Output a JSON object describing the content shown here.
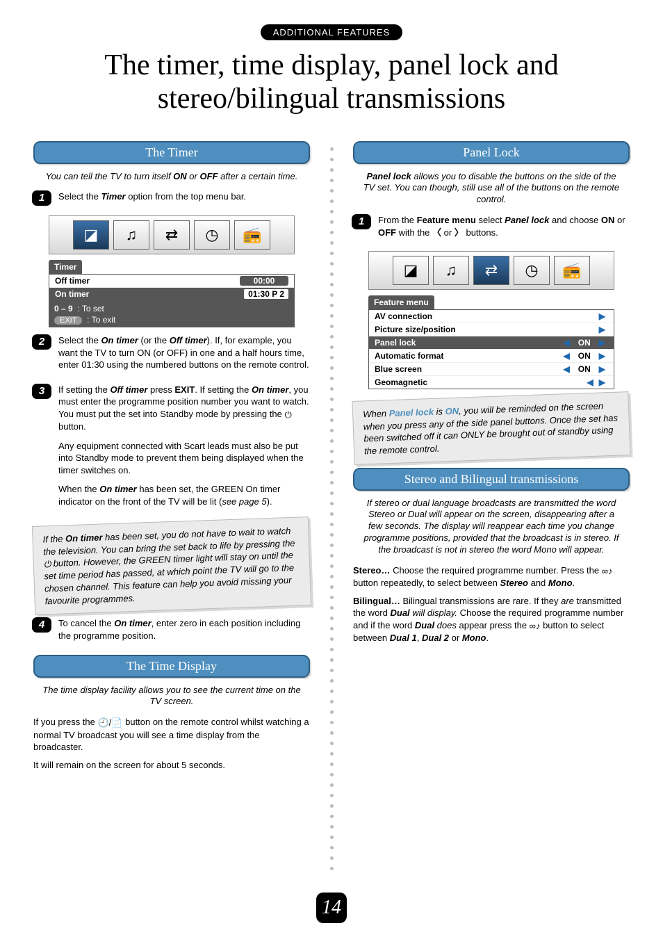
{
  "header": {
    "pill": "ADDITIONAL FEATURES",
    "title": "The timer, time display, panel lock and stereo/bilingual transmissions"
  },
  "page_number": "14",
  "left": {
    "timer": {
      "heading": "The Timer",
      "intro_a": "You can tell the TV to turn itself ",
      "intro_on": "ON",
      "intro_b": " or ",
      "intro_off": "OFF",
      "intro_c": " after a certain time.",
      "step1_a": "Select the ",
      "step1_timer": "Timer",
      "step1_b": " option from the top menu bar.",
      "menu_title": "Timer",
      "row_off_label": "Off timer",
      "row_off_val": "00:00",
      "row_on_label": "On timer",
      "row_on_val": "01:30  P 2",
      "footer_keys": "0 – 9",
      "footer_keys_label": ": To set",
      "footer_exit": "EXIT",
      "footer_exit_label": ": To exit",
      "step2_a": "Select the ",
      "step2_on": "On timer",
      "step2_b": " (or the ",
      "step2_off": "Off timer",
      "step2_c": "). If, for example, you want the TV to turn ON (or OFF) in one and a half hours time, enter 01:30 using the numbered buttons on the remote control.",
      "step3_a": "If setting the ",
      "step3_off": "Off timer",
      "step3_b": " press ",
      "step3_exit": "EXIT",
      "step3_c": ". If setting the ",
      "step3_on": "On timer",
      "step3_d": ", you must enter the programme position number you want to watch. You must put the set into Standby mode by pressing the ",
      "step3_e": " button.",
      "step3_p2": "Any equipment connected with Scart leads must also be put into Standby mode to prevent them being displayed when the timer switches on.",
      "step3_p3_a": "When the ",
      "step3_p3_on": "On timer",
      "step3_p3_b": " has been set, the GREEN On timer indicator on the front of the TV will be lit (",
      "step3_p3_c": "see page 5",
      "step3_p3_d": ").",
      "note_a": "If the ",
      "note_on": "On timer",
      "note_b": " has been set, you do not have to wait to watch the television. You can bring the set back to life by pressing the ",
      "note_c": " button. However, the GREEN timer light will stay on until the set time period has passed, at which point the TV will go to the chosen channel. This feature can help you avoid missing your favourite programmes.",
      "step4_a": "To cancel the ",
      "step4_on": "On timer",
      "step4_b": ", enter zero in each position including the programme position."
    },
    "time_display": {
      "heading": "The Time Display",
      "intro": "The time display facility allows you to see the current time on the TV screen.",
      "p1_a": "If you press the ",
      "p1_b": " button on the remote control whilst watching a normal TV broadcast you will see a time display from the broadcaster.",
      "p2": "It will remain on the screen for about 5 seconds."
    }
  },
  "right": {
    "panel_lock": {
      "heading": "Panel Lock",
      "intro_a": "Panel lock",
      "intro_b": " allows you to disable the buttons on the side of the TV set. You can though, still use all of the buttons on the remote control.",
      "step1_a": "From the ",
      "step1_fm": "Feature menu",
      "step1_b": " select ",
      "step1_pl": "Panel lock",
      "step1_c": " and choose ",
      "step1_on": "ON",
      "step1_d": " or ",
      "step1_off": "OFF",
      "step1_e": " with the ",
      "step1_f": " or ",
      "step1_g": " buttons.",
      "menu_title": "Feature menu",
      "rows": [
        {
          "label": "AV connection",
          "val": "",
          "arrowR": true
        },
        {
          "label": "Picture size/position",
          "val": "",
          "arrowR": true
        },
        {
          "label": "Panel lock",
          "val": "ON",
          "arrowL": true,
          "arrowR": true,
          "hl": true
        },
        {
          "label": "Automatic format",
          "val": "ON",
          "arrowL": true,
          "arrowR": true
        },
        {
          "label": "Blue screen",
          "val": "ON",
          "arrowL": true,
          "arrowR": true
        },
        {
          "label": "Geomagnetic",
          "val": "",
          "arrowL": true,
          "arrowR": true
        }
      ],
      "note_a": "When ",
      "note_pl": "Panel lock",
      "note_b": " is ",
      "note_on": "ON",
      "note_c": ", you will be reminded on the screen when you press any of the side panel buttons. Once the set has been switched off it can ONLY be brought out of standby using the remote control."
    },
    "stereo": {
      "heading": "Stereo and Bilingual transmissions",
      "intro": "If stereo or dual language broadcasts are transmitted the word Stereo or Dual will appear on the screen, disappearing after a few seconds. The display will reappear each time you change programme positions, provided that the broadcast is in stereo. If the broadcast is not in stereo the word Mono will appear.",
      "stereo_head": "Stereo…",
      "stereo_a": " Choose the required programme number. Press the ",
      "stereo_b": " button repeatedly, to select between ",
      "stereo_s": "Stereo",
      "stereo_c": " and ",
      "stereo_m": "Mono",
      "stereo_d": ".",
      "bil_head": "Bilingual…",
      "bil_a": " Bilingual transmissions are rare. If they ",
      "bil_are": "are",
      "bil_b": " transmitted the word ",
      "bil_dual": "Dual",
      "bil_c": " will display.",
      "bil_d": " Choose the required programme number and if the word ",
      "bil_e": " does",
      "bil_f": " appear press the ",
      "bil_g": " button to select between ",
      "bil_d1": "Dual 1",
      "bil_h": ", ",
      "bil_d2": "Dual 2",
      "bil_i": " or ",
      "bil_mono": "Mono",
      "bil_j": "."
    }
  }
}
